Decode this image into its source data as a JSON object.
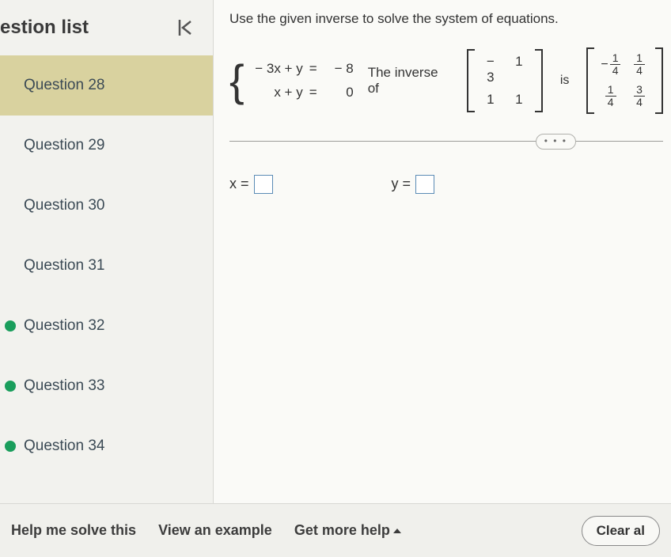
{
  "sidebar": {
    "title": "estion list",
    "items": [
      {
        "label": "Question 28",
        "active": true,
        "dot": false
      },
      {
        "label": "Question 29",
        "active": false,
        "dot": false
      },
      {
        "label": "Question 30",
        "active": false,
        "dot": false
      },
      {
        "label": "Question 31",
        "active": false,
        "dot": false
      },
      {
        "label": "Question 32",
        "active": false,
        "dot": true
      },
      {
        "label": "Question 33",
        "active": false,
        "dot": true
      },
      {
        "label": "Question 34",
        "active": false,
        "dot": true
      }
    ]
  },
  "main": {
    "instruction": "Use the given inverse to solve the system of equations.",
    "equations": [
      {
        "lhs": "− 3x + y",
        "eq": "=",
        "rhs": "− 8"
      },
      {
        "lhs": "x + y",
        "eq": "=",
        "rhs": "0"
      }
    ],
    "inverse_label": "The inverse of",
    "matrixA": [
      [
        "− 3",
        "1"
      ],
      [
        "1",
        "1"
      ]
    ],
    "is_label": "is",
    "matrixInv": {
      "r1c1": {
        "neg": true,
        "num": "1",
        "den": "4"
      },
      "r1c2": {
        "neg": false,
        "num": "1",
        "den": "4"
      },
      "r2c1": {
        "neg": false,
        "num": "1",
        "den": "4"
      },
      "r2c2": {
        "neg": false,
        "num": "3",
        "den": "4"
      }
    },
    "ellipsis": "• • •",
    "answers": {
      "x_label": "x =",
      "y_label": "y =",
      "x_value": "",
      "y_value": ""
    }
  },
  "footer": {
    "help": "Help me solve this",
    "example": "View an example",
    "more": "Get more help",
    "clear": "Clear al"
  },
  "chart_data": {
    "type": "table",
    "equations": [
      {
        "expr": "-3x + y = -8"
      },
      {
        "expr": "x + y = 0"
      }
    ],
    "coefficient_matrix": [
      [
        -3,
        1
      ],
      [
        1,
        1
      ]
    ],
    "inverse_matrix": [
      [
        -0.25,
        0.25
      ],
      [
        0.25,
        0.75
      ]
    ]
  }
}
